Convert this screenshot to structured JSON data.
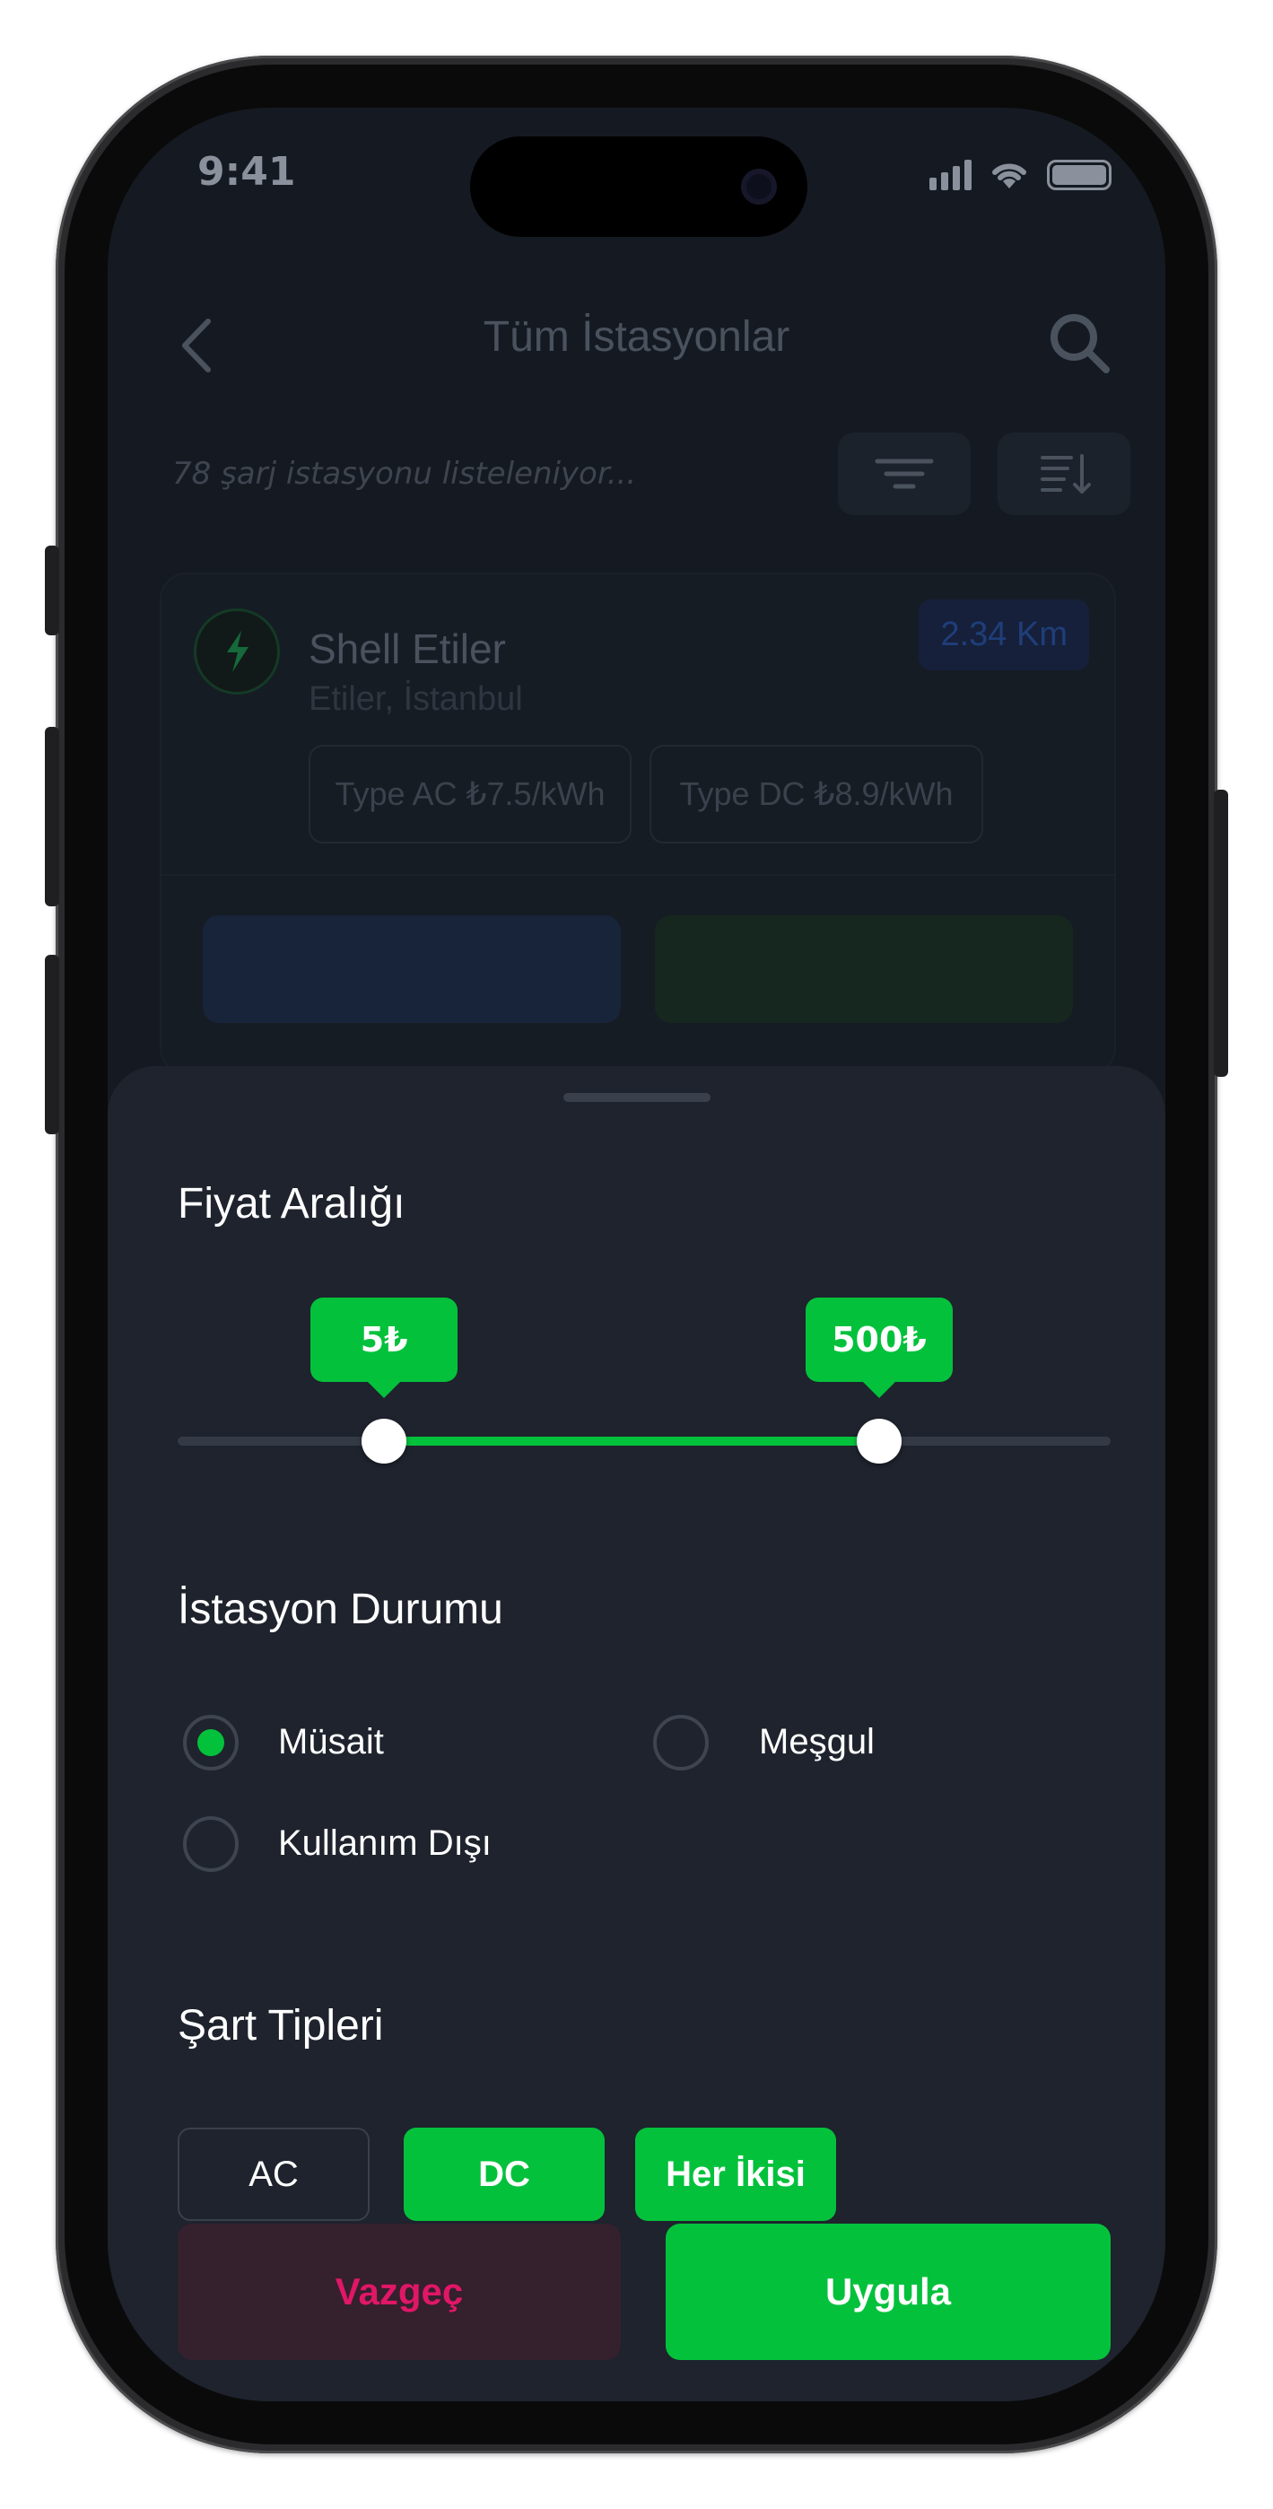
{
  "status_bar": {
    "time": "9:41"
  },
  "background": {
    "header_title": "Tüm İstasyonlar",
    "count_text": "78 şarj istasyonu listeleniyor...",
    "station": {
      "name": "Shell Etiler",
      "location": "Etiler, İstanbul",
      "distance": "2.34 Km",
      "prices": [
        "Type AC ₺7.5/kWh",
        "Type DC ₺8.9/kWh"
      ]
    }
  },
  "sheet": {
    "price_range": {
      "title": "Fiyat Aralığı",
      "min_label": "5₺",
      "max_label": "500₺",
      "range_min": 0,
      "range_max": 1000,
      "selected_min": 5,
      "selected_max": 500
    },
    "station_status": {
      "title": "İstasyon Durumu",
      "options": [
        {
          "label": "Müsait",
          "selected": true
        },
        {
          "label": "Meşgul",
          "selected": false
        },
        {
          "label": "Kullanım Dışı",
          "selected": false
        }
      ]
    },
    "charge_types": {
      "title": "Şart Tipleri",
      "options": [
        {
          "label": "AC",
          "selected": false
        },
        {
          "label": "DC",
          "selected": true
        },
        {
          "label": "Her İkisi",
          "selected": true
        }
      ]
    },
    "actions": {
      "cancel": "Vazgeç",
      "apply": "Uygula"
    }
  },
  "colors": {
    "accent": "#04C13C",
    "cancel_text": "#E01667",
    "sheet_bg": "#1E232D"
  }
}
